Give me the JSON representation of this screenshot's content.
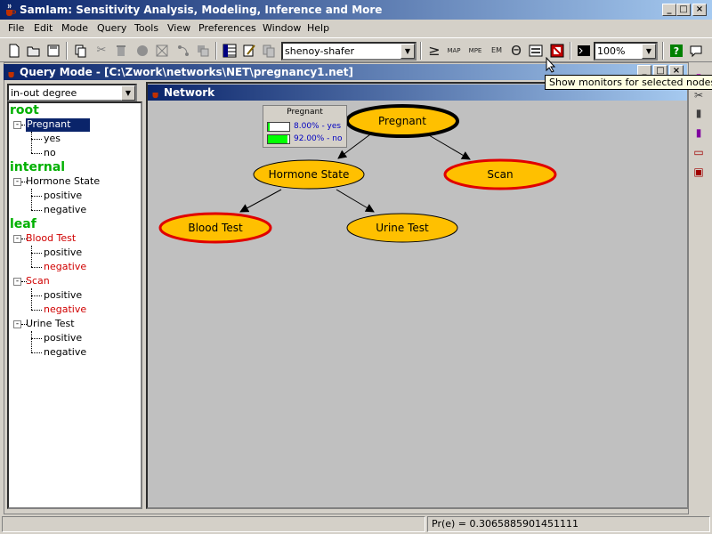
{
  "window": {
    "title": "SamIam: Sensitivity Analysis, Modeling, Inference and More",
    "minimize": "_",
    "maximize": "□",
    "close": "×"
  },
  "menu": [
    "File",
    "Edit",
    "Mode",
    "Query",
    "Tools",
    "View",
    "Preferences",
    "Window",
    "Help"
  ],
  "toolbar": {
    "algorithm_value": "shenoy-shafer",
    "zoom_value": "100%",
    "tooltip": "Show monitors for selected nodes",
    "glyphs": {
      "geq": "≥",
      "map": "MAP",
      "mpe": "MPE",
      "em": "EM",
      "theta": "Θ"
    }
  },
  "query_window": {
    "title": "Query Mode - [C:\\Zwork\\networks\\NET\\pregnancy1.net]"
  },
  "tree": {
    "sort_value": "in-out degree",
    "groups": [
      {
        "heading": "root",
        "nodes": [
          {
            "name": "Pregnant",
            "selected": true,
            "states": [
              "yes",
              "no"
            ]
          }
        ]
      },
      {
        "heading": "internal",
        "nodes": [
          {
            "name": "Hormone State",
            "states": [
              "positive",
              "negative"
            ]
          }
        ]
      },
      {
        "heading": "leaf",
        "nodes": [
          {
            "name": "Blood Test",
            "red": true,
            "states": [
              "positive",
              "negative"
            ]
          },
          {
            "name": "Scan",
            "red": true,
            "states": [
              "positive",
              "negative"
            ]
          },
          {
            "name": "Urine Test",
            "states": [
              "positive",
              "negative"
            ]
          }
        ]
      }
    ]
  },
  "network": {
    "title": "Network",
    "nodes": {
      "pregnant": "Pregnant",
      "hormone_state": "Hormone State",
      "scan": "Scan",
      "blood_test": "Blood Test",
      "urine_test": "Urine Test"
    },
    "monitor": {
      "title": "Pregnant",
      "rows": [
        {
          "label": "8.00% - yes",
          "fraction": 0.08
        },
        {
          "label": "92.00% - no",
          "fraction": 0.92
        }
      ]
    }
  },
  "status": {
    "left": "",
    "probability": "Pr(e) = 0.3065885901451111"
  },
  "colors": {
    "node_fill": "#ffc000",
    "node_border_observed": "#e00000",
    "node_border_normal": "#000000",
    "title_gradient_start": "#0a246a",
    "title_gradient_end": "#a6caf0",
    "tree_heading": "#00b000",
    "monitor_bar": "#00ff00",
    "monitor_text": "#0000c0"
  }
}
